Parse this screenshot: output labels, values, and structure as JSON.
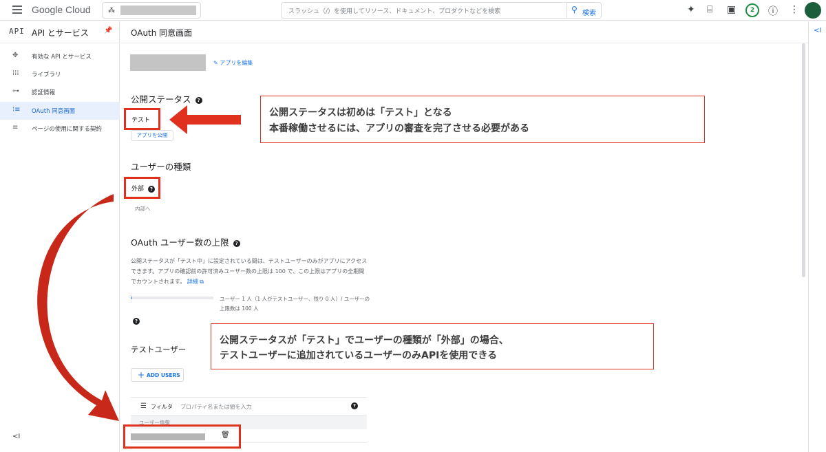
{
  "topbar": {
    "logo": "Google Cloud",
    "search_placeholder": "スラッシュ（/）を使用してリソース、ドキュメント、プロダクトなどを検索",
    "search_button": "検索",
    "notification_count": "2"
  },
  "sidebar": {
    "logo": "API",
    "title": "API とサービス",
    "items": [
      {
        "label": "有効な API とサービス",
        "icon": "hub-icon"
      },
      {
        "label": "ライブラリ",
        "icon": "library-icon"
      },
      {
        "label": "認証情報",
        "icon": "key-icon"
      },
      {
        "label": "OAuth 同意画面",
        "icon": "consent-icon",
        "active": true
      },
      {
        "label": "ページの使用に関する契約",
        "icon": "settings-list-icon"
      }
    ]
  },
  "main": {
    "page_title": "OAuth 同意画面",
    "edit_app": "アプリを編集",
    "publish_status": {
      "heading": "公開ステータス",
      "value": "テスト",
      "button": "アプリを公開"
    },
    "user_type": {
      "heading": "ユーザーの種類",
      "value": "外部",
      "switch_link": "内部へ"
    },
    "oauth_limit": {
      "heading": "OAuth ユーザー数の上限",
      "description": "公開ステータスが「テスト中」に設定されている間は、テストユーザーのみがアプリにアクセスできます。アプリの確認前の許可済みユーザー数の上限は 100 で、この上限はアプリの全期間でカウントされます。",
      "details_link": "詳細",
      "usage_text": "ユーザー 1 人（1 人がテストユーザー、残り 0 人）/ ユーザーの上限数は 100 人",
      "usage_fraction": 0.01
    },
    "test_users": {
      "heading": "テストユーザー",
      "add_button": "ADD USERS",
      "filter_label": "フィルタ",
      "filter_placeholder": "プロパティ名または値を入力",
      "column_header": "ユーザー情報"
    }
  },
  "annotations": {
    "callout1": [
      "公開ステータスは初めは「テスト」となる",
      "本番稼働させるには、アプリの審査を完了させる必要がある"
    ],
    "callout2": [
      "公開ステータスが「テスト」でユーザーの種類が「外部」の場合、",
      "テストユーザーに追加されているユーザーのみAPIを使用できる"
    ],
    "color": "#e0301e"
  }
}
